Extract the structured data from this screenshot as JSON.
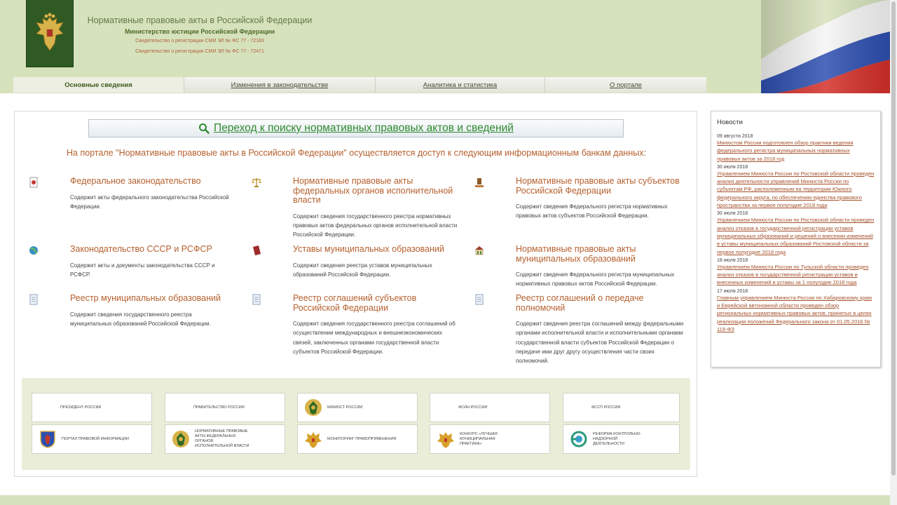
{
  "header": {
    "title": "Нормативные правовые акты в Российской Федерации",
    "ministry": "Министерство юстиции Российской Федерации",
    "reg1": "Свидетельство о регистрации СМИ ЭЛ № ФС 77 - 72183",
    "reg2": "Свидетельство о регистрации СМИ ЭЛ № ФС 77 - 72471"
  },
  "nav": {
    "tabs": [
      {
        "label": "Основные сведения"
      },
      {
        "label": "Изменения в законодательстве"
      },
      {
        "label": "Аналитика и статистика"
      },
      {
        "label": "О портале"
      }
    ]
  },
  "search": {
    "label": "Переход к поиску нормативных правовых актов и сведений"
  },
  "intro": "На портале \"Нормативные правовые акты в Российской Федерации\" осуществляется доступ к следующим информационным банкам данных:",
  "categories": [
    {
      "title": "Федеральное законодательство",
      "desc": "Содержит акты федерального законодательства Российской Федерации.",
      "icon": "document-seal-icon"
    },
    {
      "title": "Нормативные правовые акты федеральных органов исполнительной власти",
      "desc": "Содержит сведения государственного реестра нормативных правовых актов федеральных органов исполнительной власти Российской Федерации.",
      "icon": "scales-icon"
    },
    {
      "title": "Нормативные правовые акты субъектов Российской Федерации",
      "desc": "Содержит сведения Федерального регистра нормативных правовых актов субъектов Российской Федерации.",
      "icon": "gavel-icon"
    },
    {
      "title": "Законодательство СССР и РСФСР",
      "desc": "Содержит акты и документы законодательства СССР и РСФСР.",
      "icon": "globe-icon"
    },
    {
      "title": "Уставы муниципальных образований",
      "desc": "Содержит сведения реестра уставов муниципальных образований Российской Федерации.",
      "icon": "book-icon"
    },
    {
      "title": "Нормативные правовые акты муниципальных образований",
      "desc": "Содержит сведения Федерального регистра муниципальных нормативных правовых актов Российской Федерации.",
      "icon": "building-icon"
    },
    {
      "title": "Реестр муниципальных образований",
      "desc": "Содержит сведения государственного реестра муниципальных образований Российской Федерации.",
      "icon": "document-icon"
    },
    {
      "title": "Реестр соглашений субъектов Российской Федерации",
      "desc": "Содержит сведения государственного реестра соглашений об осуществлении международных и внешнеэкономических связей, заключенных органами государственной власти субъектов Российской Федерации.",
      "icon": "document-icon"
    },
    {
      "title": "Реестр соглашений о передаче полномочий",
      "desc": "Содержит сведения реестра соглашений между федеральными органами исполнительной власти и исполнительными органами государственной власти субъектов Российской Федерации о передаче ими друг другу осуществления части своих полномочий.",
      "icon": "document-icon"
    }
  ],
  "links": [
    {
      "label": "ПРЕЗИДЕНТ РОССИИ",
      "logo": ""
    },
    {
      "label": "ПРАВИТЕЛЬСТВО РОССИИ",
      "logo": ""
    },
    {
      "label": "МИНЮСТ РОССИИ",
      "logo": "minjust-emblem-icon"
    },
    {
      "label": "ФСИН РОССИИ",
      "logo": ""
    },
    {
      "label": "ФССП РОССИИ",
      "logo": ""
    },
    {
      "label": "ПОРТАЛ ПРАВОВОЙ ИНФОРМАЦИИ",
      "logo": "coat-of-arms-icon"
    },
    {
      "label": "НОРМАТИВНЫЕ ПРАВОВЫЕ АКТЫ ФЕДЕРАЛЬНЫХ ОРГАНОВ ИСПОЛНИТЕЛЬНОЙ ВЛАСТИ",
      "logo": "minjust-emblem-icon"
    },
    {
      "label": "МОНИТОРИНГ ПРАВОПРИМЕНЕНИЯ",
      "logo": "eagle-icon"
    },
    {
      "label": "КОНКУРС «ЛУЧШАЯ МУНИЦИПАЛЬНАЯ ПРАКТИКА»",
      "logo": "eagle-icon"
    },
    {
      "label": "РЕФОРМА КОНТРОЛЬНО-НАДЗОРНОЙ ДЕЯТЕЛЬНОСТИ",
      "logo": "reform-icon"
    }
  ],
  "news": {
    "title": "Новости",
    "items": [
      {
        "date": "09 августа 2018",
        "text": "Минюстом России подготовлен обзор практики ведения федерального регистра муниципальных нормативных правовых актов за 2018 год"
      },
      {
        "date": "30 июля 2018",
        "text": "Управлением Минюста России по Ростовской области проведен анализ деятельности управлений Минюста России по субъектам РФ, расположенным на территории Южного федерального округа, по обеспечению единства правового пространства за первое полугодие 2018 года"
      },
      {
        "date": "30 июля 2018",
        "text": "Управлением Минюста России по Ростовской области проведен анализ отказов в государственной регистрации уставов муниципальных образований и решений о внесении изменений в уставы муниципальных образований Ростовской области за первое полугодие 2018 года"
      },
      {
        "date": "18 июля 2018",
        "text": "Управлением Минюста России по Тульской области проведен анализ отказов в государственной регистрации уставов и внесенных изменений в уставы за 1 полугодие 2018 года"
      },
      {
        "date": "17 июля 2018",
        "text": "Главным управлением Минюста России по Хабаровскому краю и Еврейской автономной области проведен обзор региональных нормативных правовых актов, принятых в целях реализации положений Федерального закона от 01.05.2016 № 119-ФЗ"
      }
    ]
  }
}
